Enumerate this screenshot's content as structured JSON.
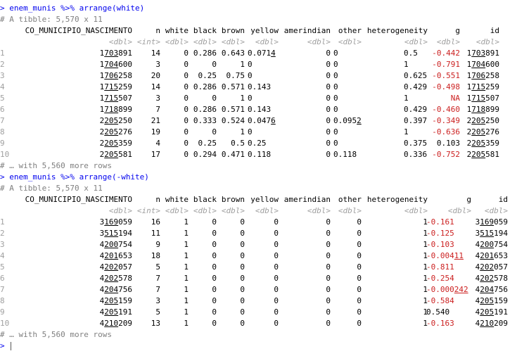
{
  "console": {
    "prompt": ">",
    "block1": {
      "command": "enem_munis %>% arrange(white)",
      "tibble_note": "# A tibble: 5,570 x 11",
      "headers": [
        "CO_MUNICIPIO_NASCIMENTO",
        "n",
        "white",
        "black",
        "brown",
        "yellow",
        "amerindian",
        "other",
        "heterogeneity",
        "g",
        "id"
      ],
      "types": [
        "<dbl>",
        "<int>",
        "<dbl>",
        "<dbl>",
        "<dbl>",
        "<dbl>",
        "<dbl>",
        "<dbl>",
        "<dbl>",
        "<dbl>",
        "<dbl>"
      ],
      "rows": [
        {
          "num": "1",
          "code": "1703891",
          "n": "14",
          "white": "0",
          "black": "0.286",
          "brown": "0.643",
          "yellow": "0.0714",
          "amerindian": "0",
          "other": "0",
          "het": "0.5",
          "g": "-0.442",
          "id": "1703891"
        },
        {
          "num": "2",
          "code": "1704600",
          "n": "3",
          "white": "0",
          "black": "0",
          "brown": "1",
          "yellow": "0",
          "amerindian": "0",
          "other": "0",
          "het": "1",
          "g": "-0.791",
          "id": "1704600"
        },
        {
          "num": "3",
          "code": "1706258",
          "n": "20",
          "white": "0",
          "black": "0.25",
          "brown": "0.75",
          "yellow": "0",
          "amerindian": "0",
          "other": "0",
          "het": "0.625",
          "g": "-0.551",
          "id": "1706258"
        },
        {
          "num": "4",
          "code": "1715259",
          "n": "14",
          "white": "0",
          "black": "0.286",
          "brown": "0.571",
          "yellow": "0.143",
          "amerindian": "0",
          "other": "0",
          "het": "0.429",
          "g": "-0.498",
          "id": "1715259"
        },
        {
          "num": "5",
          "code": "1715507",
          "n": "3",
          "white": "0",
          "black": "0",
          "brown": "1",
          "yellow": "0",
          "amerindian": "0",
          "other": "0",
          "het": "1",
          "g": "NA",
          "id": "1715507"
        },
        {
          "num": "6",
          "code": "1718899",
          "n": "7",
          "white": "0",
          "black": "0.286",
          "brown": "0.571",
          "yellow": "0.143",
          "amerindian": "0",
          "other": "0",
          "het": "0.429",
          "g": "-0.460",
          "id": "1718899"
        },
        {
          "num": "7",
          "code": "2205250",
          "n": "21",
          "white": "0",
          "black": "0.333",
          "brown": "0.524",
          "yellow": "0.0476",
          "amerindian": "0",
          "other": "0.0952",
          "het": "0.397",
          "g": "-0.349",
          "id": "2205250"
        },
        {
          "num": "8",
          "code": "2205276",
          "n": "19",
          "white": "0",
          "black": "0",
          "brown": "1",
          "yellow": "0",
          "amerindian": "0",
          "other": "0",
          "het": "1",
          "g": "-0.636",
          "id": "2205276"
        },
        {
          "num": "9",
          "code": "2205359",
          "n": "4",
          "white": "0",
          "black": "0.25",
          "brown": "0.5",
          "yellow": "0.25",
          "amerindian": "0",
          "other": "0",
          "het": "0.375",
          "g": "0.103",
          "id": "2205359"
        },
        {
          "num": "10",
          "code": "2205581",
          "n": "17",
          "white": "0",
          "black": "0.294",
          "brown": "0.471",
          "yellow": "0.118",
          "amerindian": "0",
          "other": "0.118",
          "het": "0.336",
          "g": "-0.752",
          "id": "2205581"
        }
      ],
      "more_rows": "# … with 5,560 more rows"
    },
    "block2": {
      "command": "enem_munis %>% arrange(-white)",
      "tibble_note": "# A tibble: 5,570 x 11",
      "headers": [
        "CO_MUNICIPIO_NASCIMENTO",
        "n",
        "white",
        "black",
        "brown",
        "yellow",
        "amerindian",
        "other",
        "heterogeneity",
        "g",
        "id"
      ],
      "types": [
        "<dbl>",
        "<int>",
        "<dbl>",
        "<dbl>",
        "<dbl>",
        "<dbl>",
        "<dbl>",
        "<dbl>",
        "<dbl>",
        "<dbl>",
        "<dbl>"
      ],
      "rows": [
        {
          "num": "1",
          "code": "3169059",
          "n": "16",
          "white": "1",
          "black": "0",
          "brown": "0",
          "yellow": "0",
          "amerindian": "0",
          "other": "0",
          "het": "1",
          "g": "-0.161",
          "id": "3169059"
        },
        {
          "num": "2",
          "code": "3515194",
          "n": "11",
          "white": "1",
          "black": "0",
          "brown": "0",
          "yellow": "0",
          "amerindian": "0",
          "other": "0",
          "het": "1",
          "g": "-0.125",
          "id": "3515194"
        },
        {
          "num": "3",
          "code": "4200754",
          "n": "9",
          "white": "1",
          "black": "0",
          "brown": "0",
          "yellow": "0",
          "amerindian": "0",
          "other": "0",
          "het": "1",
          "g": "-0.103",
          "id": "4200754"
        },
        {
          "num": "4",
          "code": "4201653",
          "n": "18",
          "white": "1",
          "black": "0",
          "brown": "0",
          "yellow": "0",
          "amerindian": "0",
          "other": "0",
          "het": "1",
          "g": "-0.00411",
          "id": "4201653"
        },
        {
          "num": "5",
          "code": "4202057",
          "n": "5",
          "white": "1",
          "black": "0",
          "brown": "0",
          "yellow": "0",
          "amerindian": "0",
          "other": "0",
          "het": "1",
          "g": "-0.811",
          "id": "4202057"
        },
        {
          "num": "6",
          "code": "4202578",
          "n": "7",
          "white": "1",
          "black": "0",
          "brown": "0",
          "yellow": "0",
          "amerindian": "0",
          "other": "0",
          "het": "1",
          "g": "-0.254",
          "id": "4202578"
        },
        {
          "num": "7",
          "code": "4204756",
          "n": "7",
          "white": "1",
          "black": "0",
          "brown": "0",
          "yellow": "0",
          "amerindian": "0",
          "other": "0",
          "het": "1",
          "g": "-0.000242",
          "id": "4204756"
        },
        {
          "num": "8",
          "code": "4205159",
          "n": "3",
          "white": "1",
          "black": "0",
          "brown": "0",
          "yellow": "0",
          "amerindian": "0",
          "other": "0",
          "het": "1",
          "g": "-0.584",
          "id": "4205159"
        },
        {
          "num": "9",
          "code": "4205191",
          "n": "5",
          "white": "1",
          "black": "0",
          "brown": "0",
          "yellow": "0",
          "amerindian": "0",
          "other": "0",
          "het": "1",
          "g": "0.540",
          "id": "4205191"
        },
        {
          "num": "10",
          "code": "4210209",
          "n": "13",
          "white": "1",
          "black": "0",
          "brown": "0",
          "yellow": "0",
          "amerindian": "0",
          "other": "0",
          "het": "1",
          "g": "-0.163",
          "id": "4210209"
        }
      ],
      "more_rows": "# … with 5,560 more rows"
    }
  },
  "colors": {
    "command": "#0000ee",
    "comment": "#808080",
    "negative": "#cc2222",
    "type_hint": "#a0a0a0"
  }
}
